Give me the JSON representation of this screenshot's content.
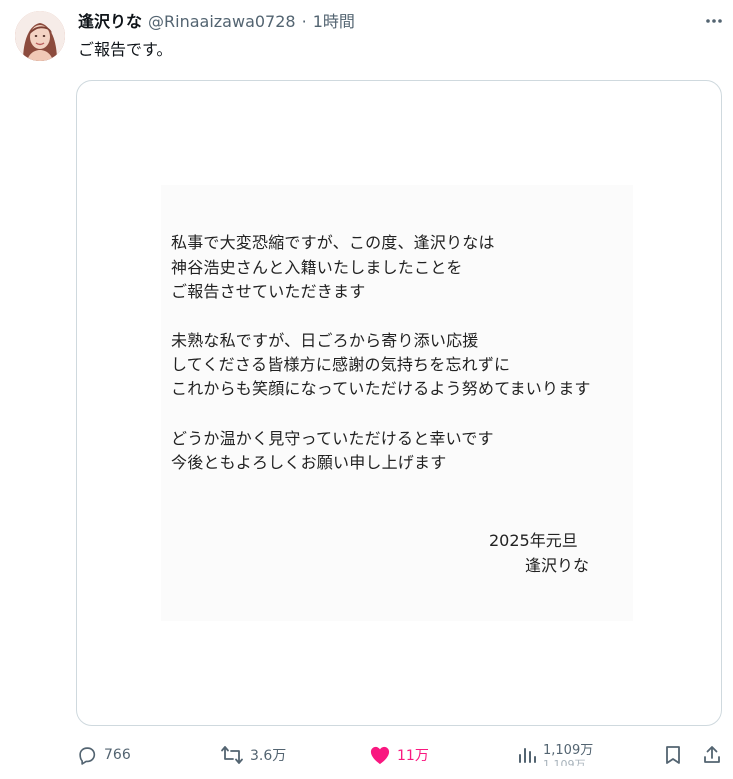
{
  "author": {
    "display_name": "逢沢りな",
    "handle": "@Rinaaizawa0728",
    "separator": "·",
    "time": "1時間",
    "avatar_icon": "avatar-photo"
  },
  "post": {
    "text": "ご報告です。"
  },
  "media": {
    "letter": {
      "lines": [
        "私事で大変恐縮ですが、この度、逢沢りなは",
        "神谷浩史さんと入籍いたしましたことを",
        "ご報告させていただきます",
        "",
        "未熟な私ですが、日ごろから寄り添い応援",
        "してくださる皆様方に感謝の気持ちを忘れずに",
        "これからも笑顔になっていただけるよう努めてまいります",
        "",
        "どうか温かく見守っていただけると幸いです",
        "今後ともよろしくお願い申し上げます"
      ],
      "date": "2025年元旦",
      "signature": "逢沢りな"
    }
  },
  "actions": {
    "reply_count": "766",
    "repost_count": "3.6万",
    "like_count": "11万",
    "views_count": "1,109万",
    "icons": {
      "reply": "reply-icon",
      "repost": "repost-icon",
      "like": "heart-icon",
      "views": "views-icon",
      "bookmark": "bookmark-icon",
      "share": "share-icon",
      "more": "more-icon"
    },
    "colors": {
      "muted": "#536471",
      "like": "#f91880"
    }
  }
}
